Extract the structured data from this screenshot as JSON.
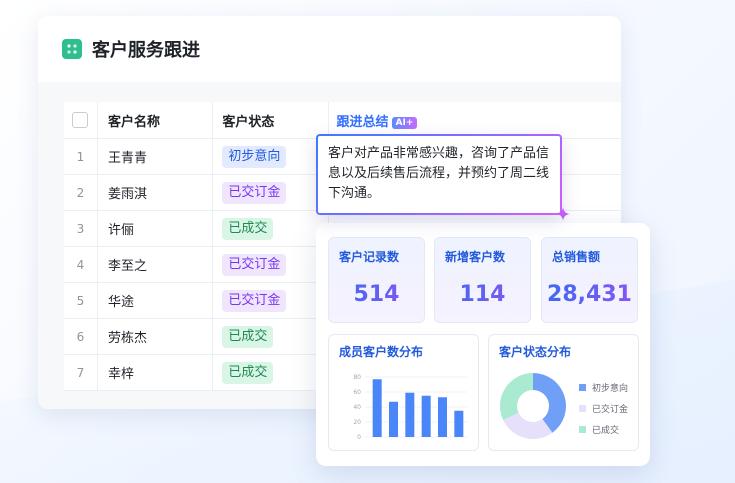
{
  "header": {
    "title": "客户服务跟进"
  },
  "table": {
    "columns": [
      "客户名称",
      "客户状态",
      "跟进总结"
    ],
    "ai_badge": "AI+",
    "rows": [
      {
        "index": "1",
        "name": "王青青",
        "status": "初步意向",
        "status_type": "blue"
      },
      {
        "index": "2",
        "name": "姜雨淇",
        "status": "已交订金",
        "status_type": "purple"
      },
      {
        "index": "3",
        "name": "许俪",
        "status": "已成交",
        "status_type": "green"
      },
      {
        "index": "4",
        "name": "李至之",
        "status": "已交订金",
        "status_type": "purple"
      },
      {
        "index": "5",
        "name": "华途",
        "status": "已交订金",
        "status_type": "purple"
      },
      {
        "index": "6",
        "name": "劳栋杰",
        "status": "已成交",
        "status_type": "green"
      },
      {
        "index": "7",
        "name": "幸梓",
        "status": "已成交",
        "status_type": "green"
      }
    ]
  },
  "summary_popup": {
    "text": "客户对产品非常感兴趣，咨询了产品信息以及后续售后流程，并预约了周二线下沟通。"
  },
  "dashboard": {
    "stats": [
      {
        "label": "客户记录数",
        "value": "514"
      },
      {
        "label": "新增客户数",
        "value": "114"
      },
      {
        "label": "总销售额",
        "value": "28,431"
      }
    ],
    "bar_panel": {
      "title": "成员客户数分布"
    },
    "pie_panel": {
      "title": "客户状态分布"
    }
  },
  "chart_data": [
    {
      "type": "bar",
      "title": "成员客户数分布",
      "y_ticks": [
        "80",
        "60",
        "40",
        "20",
        "0"
      ],
      "ylim": [
        0,
        80
      ],
      "values": [
        77,
        47,
        59,
        55,
        53,
        35
      ],
      "color": "#4a86f7"
    },
    {
      "type": "pie",
      "title": "客户状态分布",
      "labels": [
        "初步意向",
        "已交订金",
        "已成交"
      ],
      "values": [
        40,
        28,
        32
      ],
      "colors": [
        "#6f9ff6",
        "#e6e0fb",
        "#a9ead0"
      ]
    }
  ]
}
